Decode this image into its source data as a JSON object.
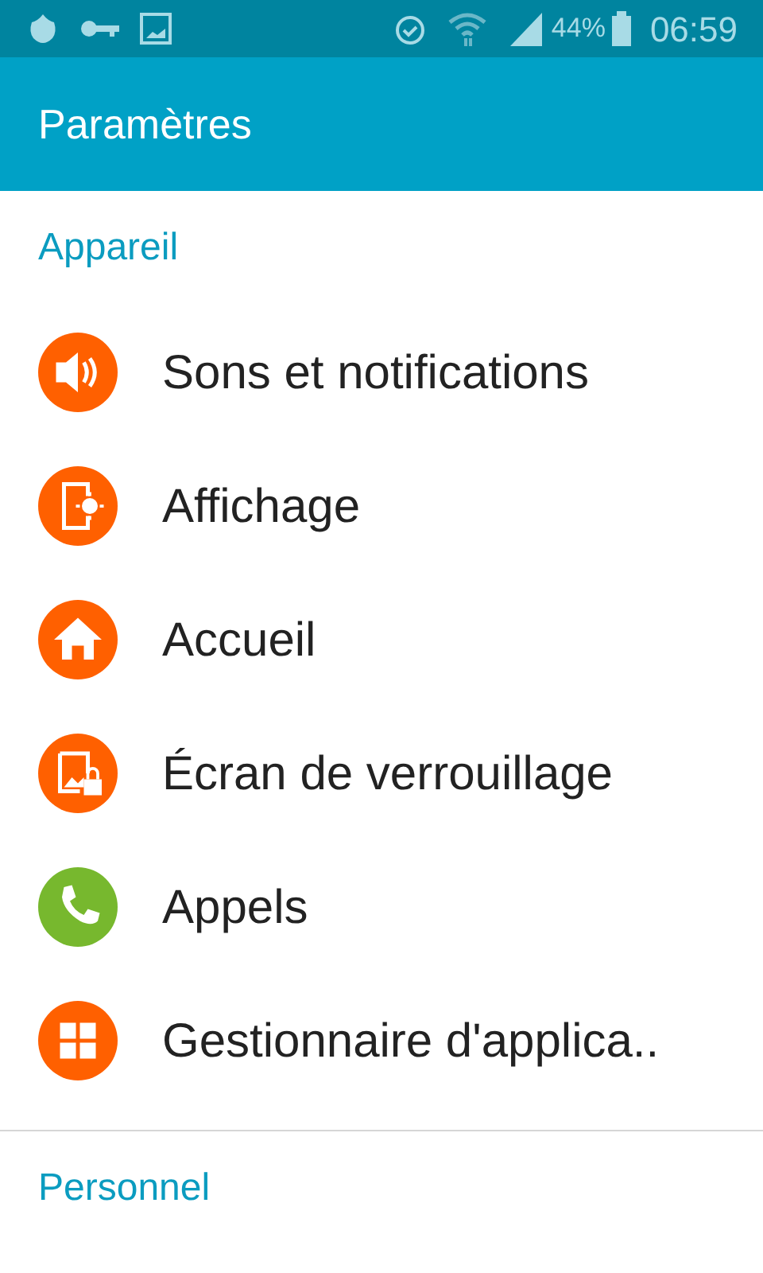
{
  "status_bar": {
    "battery_text": "44%",
    "time": "06:59"
  },
  "app_bar": {
    "title": "Paramètres"
  },
  "sections": [
    {
      "title": "Appareil",
      "items": [
        {
          "label": "Sons et notifications",
          "kind": "sound",
          "color": "#ff6000"
        },
        {
          "label": "Affichage",
          "kind": "display",
          "color": "#ff6000"
        },
        {
          "label": "Accueil",
          "kind": "home",
          "color": "#ff6000"
        },
        {
          "label": "Écran de verrouillage",
          "kind": "lock",
          "color": "#ff6000"
        },
        {
          "label": "Appels",
          "kind": "call",
          "color": "#77b82e"
        },
        {
          "label": "Gestionnaire d'applica..",
          "kind": "apps",
          "color": "#ff6000"
        }
      ]
    },
    {
      "title": "Personnel"
    }
  ]
}
